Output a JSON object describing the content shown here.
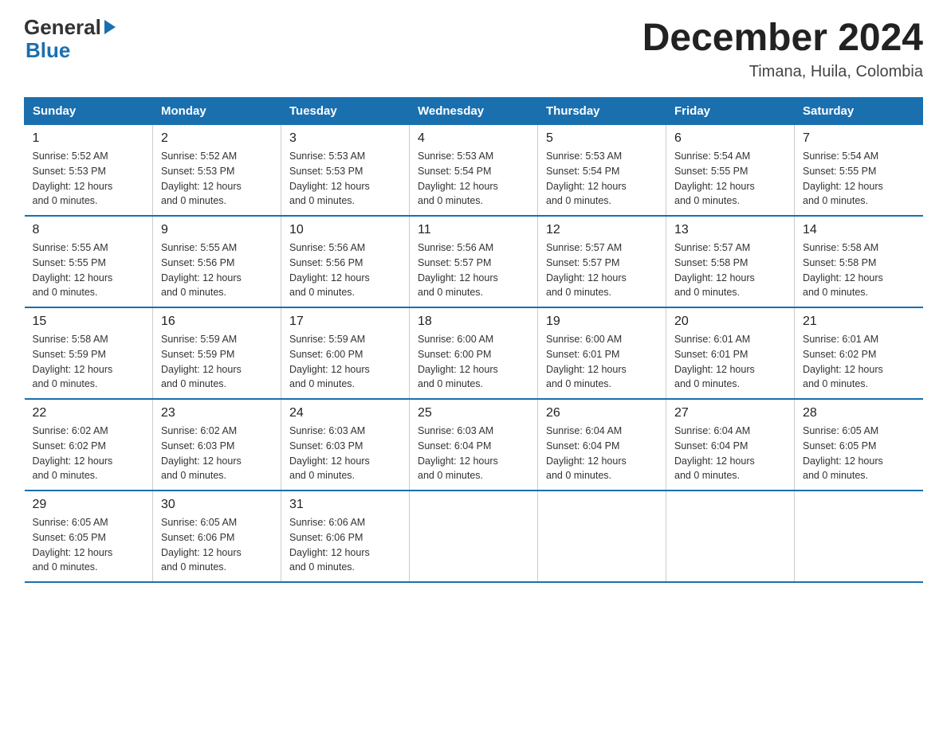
{
  "logo": {
    "text_general": "General",
    "text_blue": "Blue",
    "arrow_color": "#1a6faf"
  },
  "header": {
    "title": "December 2024",
    "subtitle": "Timana, Huila, Colombia"
  },
  "weekdays": [
    "Sunday",
    "Monday",
    "Tuesday",
    "Wednesday",
    "Thursday",
    "Friday",
    "Saturday"
  ],
  "weeks": [
    [
      {
        "day": "1",
        "sunrise": "5:52 AM",
        "sunset": "5:53 PM",
        "daylight": "12 hours and 0 minutes."
      },
      {
        "day": "2",
        "sunrise": "5:52 AM",
        "sunset": "5:53 PM",
        "daylight": "12 hours and 0 minutes."
      },
      {
        "day": "3",
        "sunrise": "5:53 AM",
        "sunset": "5:53 PM",
        "daylight": "12 hours and 0 minutes."
      },
      {
        "day": "4",
        "sunrise": "5:53 AM",
        "sunset": "5:54 PM",
        "daylight": "12 hours and 0 minutes."
      },
      {
        "day": "5",
        "sunrise": "5:53 AM",
        "sunset": "5:54 PM",
        "daylight": "12 hours and 0 minutes."
      },
      {
        "day": "6",
        "sunrise": "5:54 AM",
        "sunset": "5:55 PM",
        "daylight": "12 hours and 0 minutes."
      },
      {
        "day": "7",
        "sunrise": "5:54 AM",
        "sunset": "5:55 PM",
        "daylight": "12 hours and 0 minutes."
      }
    ],
    [
      {
        "day": "8",
        "sunrise": "5:55 AM",
        "sunset": "5:55 PM",
        "daylight": "12 hours and 0 minutes."
      },
      {
        "day": "9",
        "sunrise": "5:55 AM",
        "sunset": "5:56 PM",
        "daylight": "12 hours and 0 minutes."
      },
      {
        "day": "10",
        "sunrise": "5:56 AM",
        "sunset": "5:56 PM",
        "daylight": "12 hours and 0 minutes."
      },
      {
        "day": "11",
        "sunrise": "5:56 AM",
        "sunset": "5:57 PM",
        "daylight": "12 hours and 0 minutes."
      },
      {
        "day": "12",
        "sunrise": "5:57 AM",
        "sunset": "5:57 PM",
        "daylight": "12 hours and 0 minutes."
      },
      {
        "day": "13",
        "sunrise": "5:57 AM",
        "sunset": "5:58 PM",
        "daylight": "12 hours and 0 minutes."
      },
      {
        "day": "14",
        "sunrise": "5:58 AM",
        "sunset": "5:58 PM",
        "daylight": "12 hours and 0 minutes."
      }
    ],
    [
      {
        "day": "15",
        "sunrise": "5:58 AM",
        "sunset": "5:59 PM",
        "daylight": "12 hours and 0 minutes."
      },
      {
        "day": "16",
        "sunrise": "5:59 AM",
        "sunset": "5:59 PM",
        "daylight": "12 hours and 0 minutes."
      },
      {
        "day": "17",
        "sunrise": "5:59 AM",
        "sunset": "6:00 PM",
        "daylight": "12 hours and 0 minutes."
      },
      {
        "day": "18",
        "sunrise": "6:00 AM",
        "sunset": "6:00 PM",
        "daylight": "12 hours and 0 minutes."
      },
      {
        "day": "19",
        "sunrise": "6:00 AM",
        "sunset": "6:01 PM",
        "daylight": "12 hours and 0 minutes."
      },
      {
        "day": "20",
        "sunrise": "6:01 AM",
        "sunset": "6:01 PM",
        "daylight": "12 hours and 0 minutes."
      },
      {
        "day": "21",
        "sunrise": "6:01 AM",
        "sunset": "6:02 PM",
        "daylight": "12 hours and 0 minutes."
      }
    ],
    [
      {
        "day": "22",
        "sunrise": "6:02 AM",
        "sunset": "6:02 PM",
        "daylight": "12 hours and 0 minutes."
      },
      {
        "day": "23",
        "sunrise": "6:02 AM",
        "sunset": "6:03 PM",
        "daylight": "12 hours and 0 minutes."
      },
      {
        "day": "24",
        "sunrise": "6:03 AM",
        "sunset": "6:03 PM",
        "daylight": "12 hours and 0 minutes."
      },
      {
        "day": "25",
        "sunrise": "6:03 AM",
        "sunset": "6:04 PM",
        "daylight": "12 hours and 0 minutes."
      },
      {
        "day": "26",
        "sunrise": "6:04 AM",
        "sunset": "6:04 PM",
        "daylight": "12 hours and 0 minutes."
      },
      {
        "day": "27",
        "sunrise": "6:04 AM",
        "sunset": "6:04 PM",
        "daylight": "12 hours and 0 minutes."
      },
      {
        "day": "28",
        "sunrise": "6:05 AM",
        "sunset": "6:05 PM",
        "daylight": "12 hours and 0 minutes."
      }
    ],
    [
      {
        "day": "29",
        "sunrise": "6:05 AM",
        "sunset": "6:05 PM",
        "daylight": "12 hours and 0 minutes."
      },
      {
        "day": "30",
        "sunrise": "6:05 AM",
        "sunset": "6:06 PM",
        "daylight": "12 hours and 0 minutes."
      },
      {
        "day": "31",
        "sunrise": "6:06 AM",
        "sunset": "6:06 PM",
        "daylight": "12 hours and 0 minutes."
      },
      null,
      null,
      null,
      null
    ]
  ]
}
